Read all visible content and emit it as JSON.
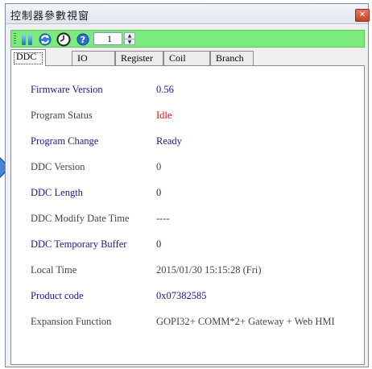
{
  "window": {
    "title": "控制器參數視窗"
  },
  "toolbar": {
    "spin_value": "1"
  },
  "tabs": [
    "DDC",
    "IO",
    "Register",
    "Coil",
    "Branch"
  ],
  "rows": [
    {
      "label": "Firmware Version",
      "value": "0.56"
    },
    {
      "label": "Program Status",
      "value": "Idle"
    },
    {
      "label": "Program Change",
      "value": "Ready"
    },
    {
      "label": "DDC Version",
      "value": "0"
    },
    {
      "label": "DDC Length",
      "value": "0"
    },
    {
      "label": "DDC Modify Date Time",
      "value": "----"
    },
    {
      "label": "DDC Temporary Buffer",
      "value": "0"
    },
    {
      "label": "Local Time",
      "value": "2015/01/30 15:15:28 (Fri)"
    },
    {
      "label": "Product code",
      "value": "0x07382585"
    },
    {
      "label": "Expansion Function",
      "value": "GOPI32+ COMM*2+ Gateway + Web HMI"
    }
  ],
  "colors": {
    "toolbar": "#7cea7c",
    "label_navy": "#1a1a8c",
    "status_red": "#e01010"
  }
}
